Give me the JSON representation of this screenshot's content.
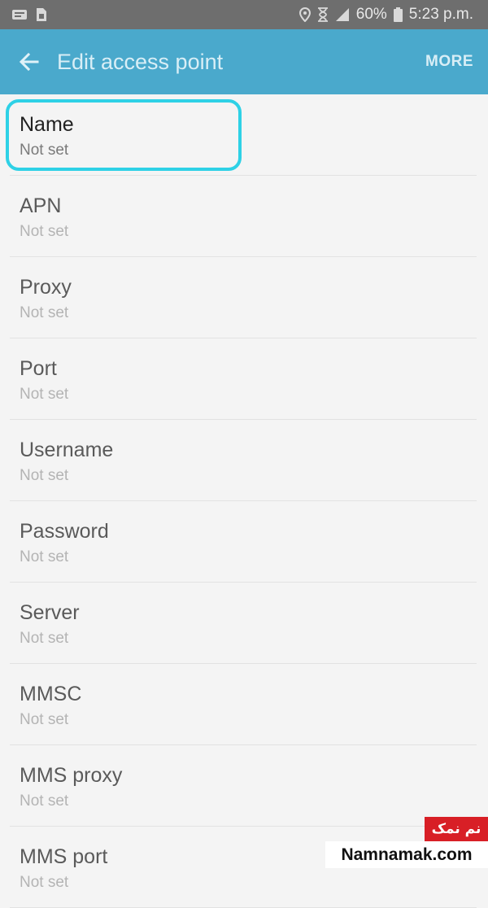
{
  "status_bar": {
    "battery": "60%",
    "time": "5:23 p.m.",
    "icons": [
      "notification-icon",
      "sim-icon",
      "location-icon",
      "hourglass-icon",
      "signal-icon",
      "battery-icon"
    ]
  },
  "app_bar": {
    "title": "Edit access point",
    "back_icon": "arrow-left-icon",
    "more_label": "MORE"
  },
  "colors": {
    "status_bar": "#6e6e6e",
    "app_bar": "#4aa9cc",
    "highlight": "#2ed1e6",
    "background": "#f4f4f4",
    "watermark_red": "#d81f26"
  },
  "settings": [
    {
      "label": "Name",
      "value": "Not set"
    },
    {
      "label": "APN",
      "value": "Not set"
    },
    {
      "label": "Proxy",
      "value": "Not set"
    },
    {
      "label": "Port",
      "value": "Not set"
    },
    {
      "label": "Username",
      "value": "Not set"
    },
    {
      "label": "Password",
      "value": "Not set"
    },
    {
      "label": "Server",
      "value": "Not set"
    },
    {
      "label": "MMSC",
      "value": "Not set"
    },
    {
      "label": "MMS proxy",
      "value": "Not set"
    },
    {
      "label": "MMS port",
      "value": "Not set"
    }
  ],
  "watermark": {
    "persian": "نم نمک",
    "site": "Namnamak.com"
  }
}
